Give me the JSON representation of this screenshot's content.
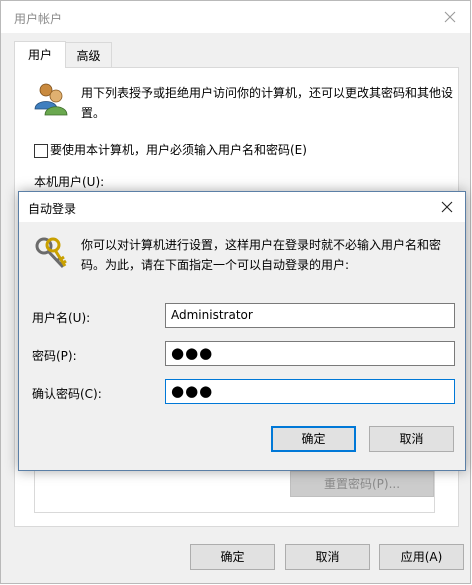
{
  "window": {
    "title": "用户帐户",
    "tabs": [
      {
        "label": "用户",
        "active": true
      },
      {
        "label": "高级",
        "active": false
      }
    ],
    "intro_text": "用下列表授予或拒绝用户访问你的计算机，还可以更改其密码和其他设置。",
    "require_password_checkbox": {
      "label": "要使用本计算机，用户必须输入用户名和密码(E)",
      "checked": false
    },
    "local_users_label": "本机用户(U):",
    "reset_password_button": "重置密码(P)...",
    "ok_button": "确定",
    "cancel_button": "取消",
    "apply_button": "应用(A)"
  },
  "dialog": {
    "title": "自动登录",
    "description": "你可以对计算机进行设置，这样用户在登录时就不必输入用户名和密码。为此，请在下面指定一个可以自动登录的用户:",
    "fields": {
      "username": {
        "label": "用户名(U):",
        "value": "Administrator"
      },
      "password": {
        "label": "密码(P):",
        "value": "●●●"
      },
      "confirm_password": {
        "label": "确认密码(C):",
        "value": "●●●"
      }
    },
    "ok_button": "确定",
    "cancel_button": "取消"
  },
  "icons": {
    "window_close": "close-icon",
    "dialog_close": "close-icon",
    "users": "users-icon",
    "key": "keys-icon"
  },
  "colors": {
    "focus_accent": "#0078d7",
    "window_background": "#f0f0f0",
    "disabled_button": "#cccccc"
  }
}
